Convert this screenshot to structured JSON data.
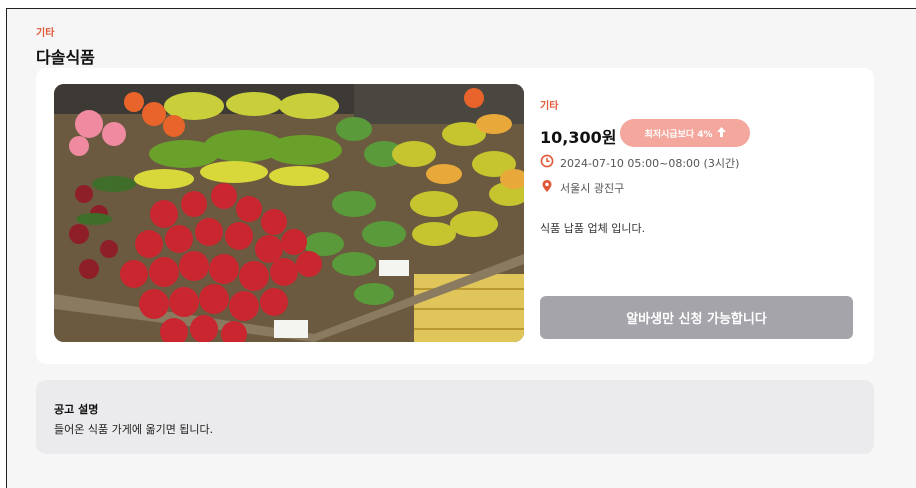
{
  "header": {
    "category": "기타",
    "title": "다솔식품"
  },
  "job": {
    "category": "기타",
    "price": "10,300원",
    "wage_badge": "최저시급보다 4%",
    "schedule": "2024-07-10 05:00~08:00 (3시간)",
    "location": "서울시 광진구",
    "short_description": "식품 납품 업체 입니다.",
    "apply_button": "알바생만 신청 가능합니다"
  },
  "posting": {
    "section_title": "공고 설명",
    "body": "들어온 식품 가게에 옮기면 됩니다."
  },
  "colors": {
    "accent": "#e05a3a",
    "badge": "#f4a79c",
    "button_disabled": "#a4a4aa"
  },
  "icons": {
    "badge": "arrow-up-icon",
    "time": "clock-icon",
    "location": "map-pin-icon"
  }
}
